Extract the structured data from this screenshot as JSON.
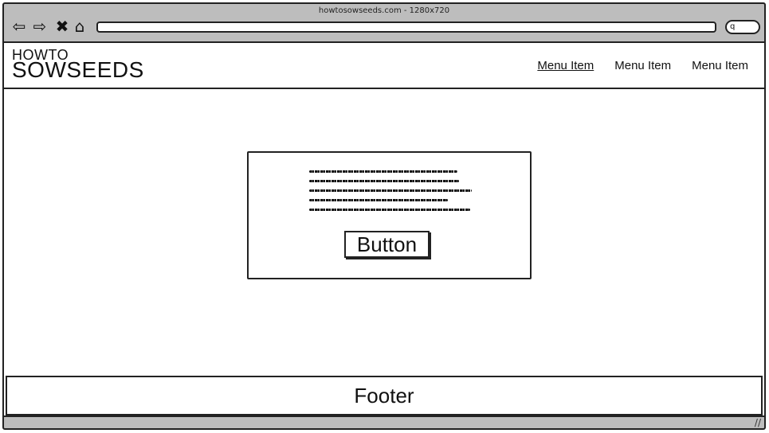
{
  "browser": {
    "title": "howtosowseeds.com - 1280x720",
    "icons": {
      "back": "back-arrow-icon",
      "forward": "forward-arrow-icon",
      "stop": "close-icon",
      "home": "home-icon",
      "search": "search-icon"
    },
    "search_glyph": "q"
  },
  "header": {
    "logo_small": "HOWTO",
    "logo_big": "SOWSEEDS",
    "menu": [
      {
        "label": "Menu Item"
      },
      {
        "label": "Menu Item"
      },
      {
        "label": "Menu Item"
      }
    ]
  },
  "card": {
    "button_label": "Button"
  },
  "footer": {
    "label": "Footer"
  },
  "status": {
    "grip": "//"
  }
}
